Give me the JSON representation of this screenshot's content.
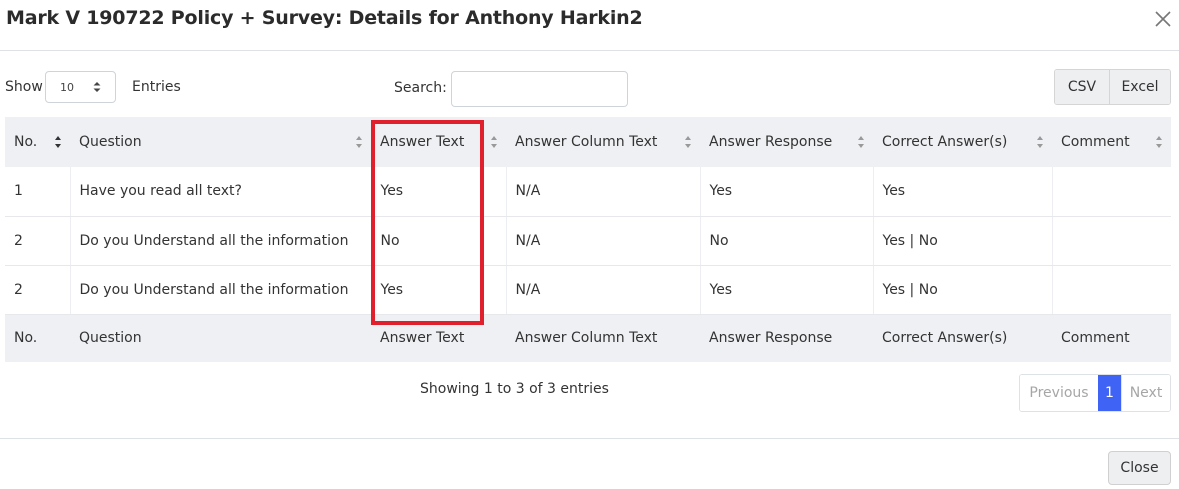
{
  "modal": {
    "title": "Mark V 190722 Policy + Survey: Details for Anthony Harkin2"
  },
  "controls": {
    "show_label": "Show",
    "entries_value": "10",
    "entries_label": "Entries",
    "search_label": "Search:",
    "search_value": "",
    "export_buttons": [
      "CSV",
      "Excel"
    ]
  },
  "table": {
    "columns": [
      "No.",
      "Question",
      "Answer Text",
      "Answer Column Text",
      "Answer Response",
      "Correct Answer(s)",
      "Comment"
    ],
    "rows": [
      [
        "1",
        "Have you read all text?",
        "Yes",
        "N/A",
        "Yes",
        "Yes",
        ""
      ],
      [
        "2",
        "Do you Understand all the information",
        "No",
        "N/A",
        "No",
        "Yes | No",
        ""
      ],
      [
        "2",
        "Do you Understand all the information",
        "Yes",
        "N/A",
        "Yes",
        "Yes | No",
        ""
      ]
    ],
    "highlighted_column": "Answer Text",
    "highlight_color": "#e0202c"
  },
  "pagination": {
    "info": "Showing 1 to 3 of 3 entries",
    "previous": "Previous",
    "current_page": "1",
    "next": "Next",
    "active_color": "#3f63f5"
  },
  "footer": {
    "close_label": "Close"
  },
  "icons": {
    "close": "close-icon",
    "sort": "sort-icon",
    "select_arrows": "select-arrows-icon"
  }
}
